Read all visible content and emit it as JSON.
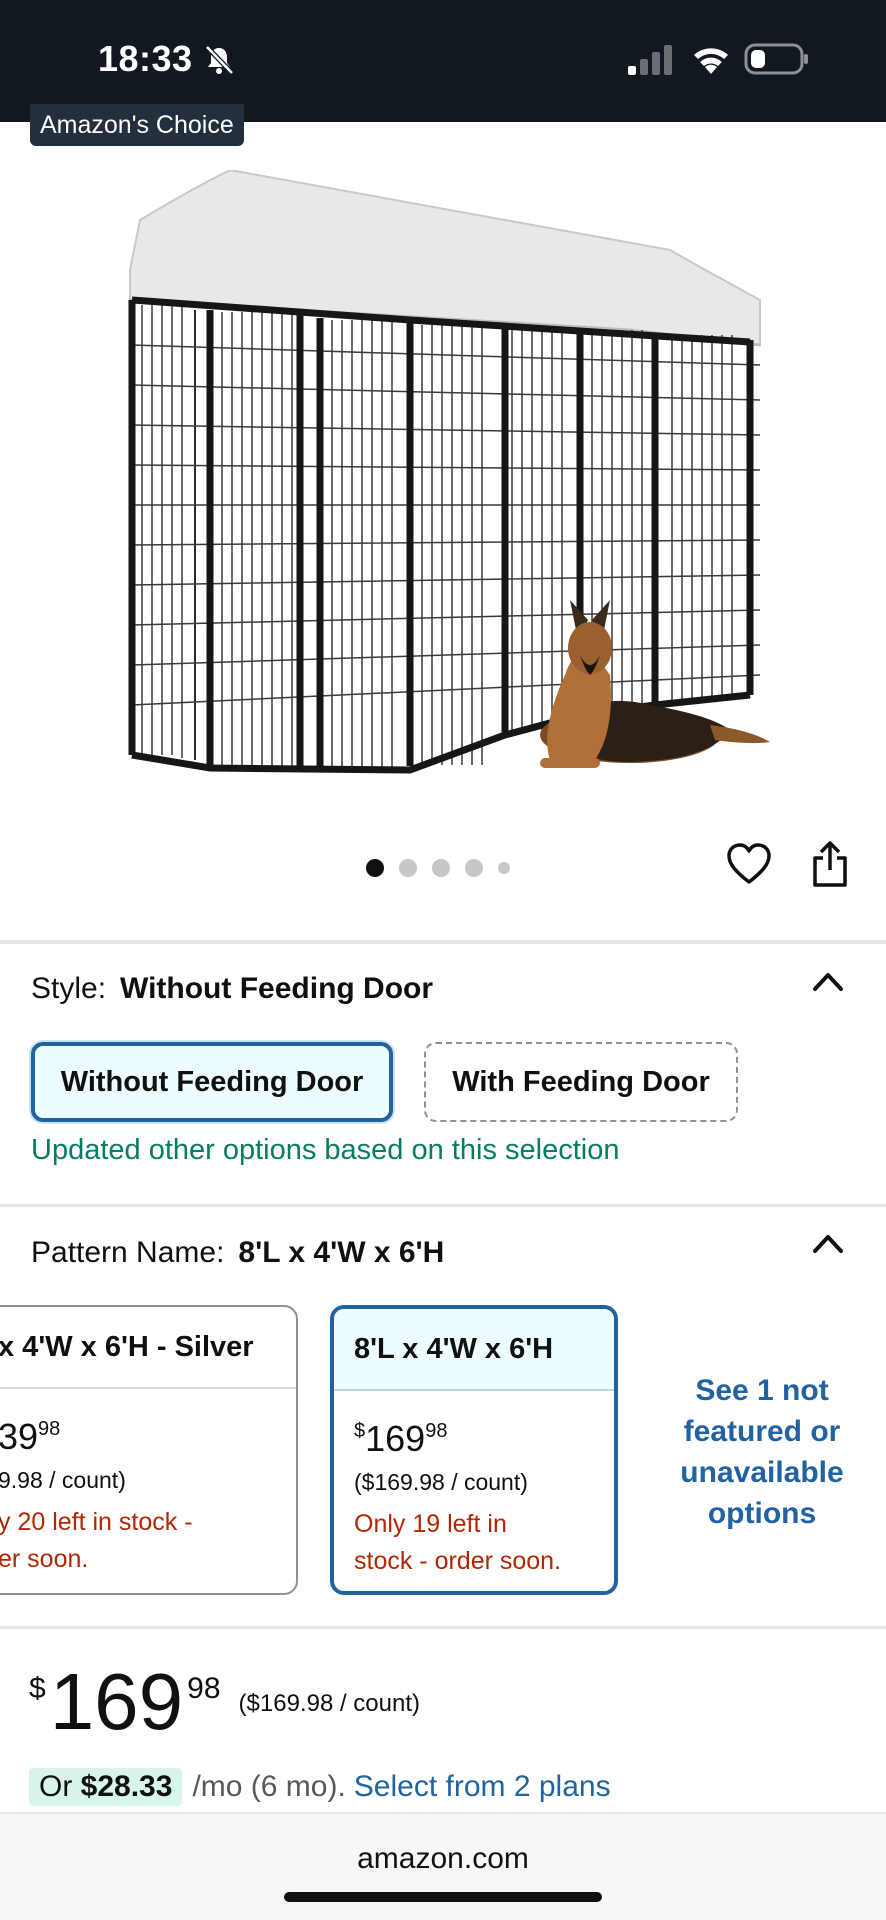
{
  "status_bar": {
    "time": "18:33",
    "wifi_icon": "wifi-icon",
    "battery_icon": "battery-icon",
    "bell_icon": "bell-slash-icon"
  },
  "product": {
    "badge": "Amazon's Choice",
    "image_alt": "dog kennel with grey cover and german shepherd",
    "carousel": {
      "total_dots": 5,
      "active_index": 0
    }
  },
  "style": {
    "label": "Style:",
    "value": "Without Feeding Door",
    "options": [
      {
        "label": "Without Feeding Door",
        "selected": true
      },
      {
        "label": "With Feeding Door",
        "selected": false
      }
    ],
    "update_note": "Updated other options based on this selection"
  },
  "pattern": {
    "label": "Pattern Name:",
    "value": "8'L x 4'W x 6'H",
    "cards": [
      {
        "title": "x 4'W x 6'H - Silver",
        "price_whole": "39",
        "price_frac": "98",
        "unit": "9.98 / count)",
        "stock_1": "y 20 left in stock -",
        "stock_2": "er soon."
      },
      {
        "title": "8'L x 4'W x 6'H",
        "price_symbol": "$",
        "price_whole": "169",
        "price_frac": "98",
        "unit": "($169.98 / count)",
        "stock_1": "Only 19 left in",
        "stock_2": "stock - order soon."
      }
    ],
    "see_more_1": "See 1 not",
    "see_more_2": "featured or",
    "see_more_3": "unavailable",
    "see_more_4": "options"
  },
  "price": {
    "symbol": "$",
    "whole": "169",
    "fraction": "98",
    "unit": "($169.98 / count)",
    "monthly_prefix": "Or ",
    "monthly_amount": "$28.33",
    "monthly_suffix": "/mo (6 mo).",
    "monthly_link": "Select from 2 plans"
  },
  "browser": {
    "url": "amazon.com"
  },
  "colors": {
    "link": "#2162a1",
    "stock_red": "#b12704",
    "green": "#067d62",
    "status_bg": "#121820"
  }
}
